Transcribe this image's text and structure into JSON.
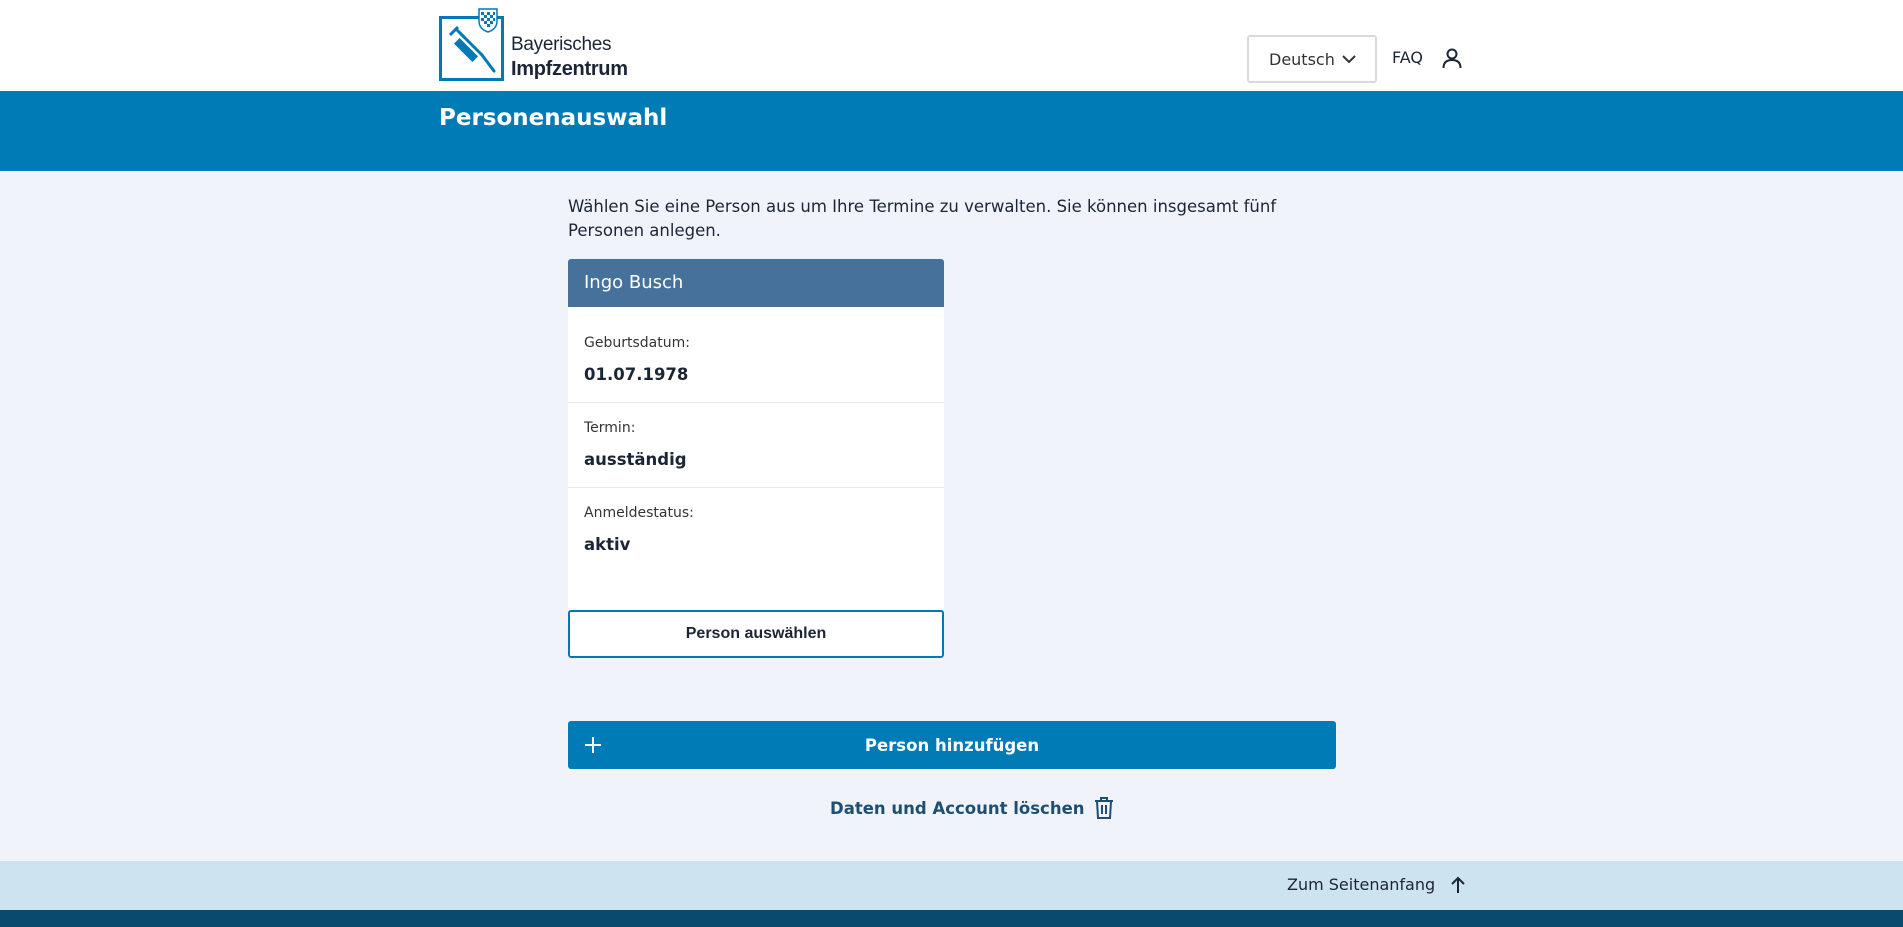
{
  "header": {
    "logo_line1": "Bayerisches",
    "logo_line2": "Impfzentrum",
    "language": "Deutsch",
    "faq": "FAQ"
  },
  "page_title": "Personenauswahl",
  "intro": "Wählen Sie eine Person aus um Ihre Termine zu verwalten. Sie können insgesamt fünf Personen anlegen.",
  "person": {
    "name": "Ingo Busch",
    "fields": [
      {
        "label": "Geburtsdatum:",
        "value": "01.07.1978"
      },
      {
        "label": "Termin:",
        "value": "ausständig"
      },
      {
        "label": "Anmeldestatus:",
        "value": "aktiv"
      }
    ],
    "select_label": "Person auswählen"
  },
  "add_person_label": "Person hinzufügen",
  "delete_label": "Daten und Account löschen",
  "footer": {
    "to_top": "Zum Seitenanfang"
  },
  "colors": {
    "primary": "#007bb6",
    "card_header": "#46719a",
    "background": "#f1f3fa",
    "footer_strip": "#cde3ef",
    "footer_dark": "#0a4a6e"
  }
}
